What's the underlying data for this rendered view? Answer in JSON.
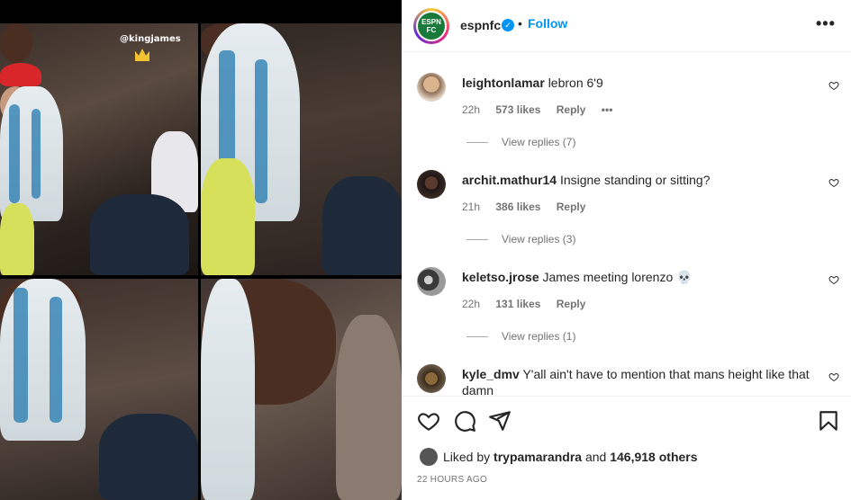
{
  "media": {
    "overlay_tag": "@kingjames"
  },
  "header": {
    "account_name": "espnfc",
    "avatar_logo_text": "ESPN FC",
    "separator": "•",
    "follow_label": "Follow",
    "more_label": "•••"
  },
  "comments": [
    {
      "user": "leightonlamar",
      "text": "lebron 6'9",
      "age": "22h",
      "likes": "573 likes",
      "reply": "Reply",
      "options": "•••",
      "replies": "View replies (7)"
    },
    {
      "user": "archit.mathur14",
      "text": "Insigne standing or sitting?",
      "age": "21h",
      "likes": "386 likes",
      "reply": "Reply",
      "replies": "View replies (3)"
    },
    {
      "user": "keletso.jrose",
      "text": "James meeting lorenzo 💀",
      "age": "22h",
      "likes": "131 likes",
      "reply": "Reply",
      "replies": "View replies (1)"
    },
    {
      "user": "kyle_dmv",
      "text": "Y'all ain't have to mention that mans height like that damn"
    }
  ],
  "actions": {
    "liked_by_prefix": "Liked by",
    "liked_by_user": "trypamarandra",
    "liked_by_and": "and",
    "liked_by_others": "146,918 others",
    "timestamp": "22 HOURS AGO"
  },
  "icons": [
    "heart-icon",
    "comment-icon",
    "share-icon",
    "bookmark-icon",
    "verified-icon",
    "crown-icon",
    "more-icon"
  ],
  "colors": {
    "follow_blue": "#0095f6",
    "verified_blue": "#0095f6",
    "meta_grey": "#737373"
  }
}
